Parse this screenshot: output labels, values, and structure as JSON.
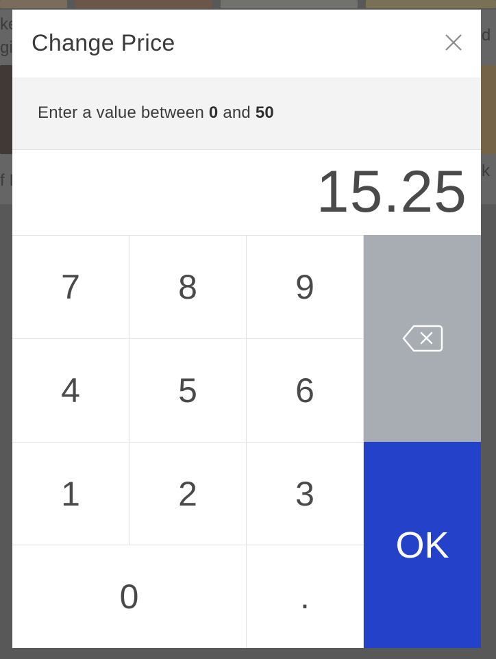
{
  "background": {
    "snippets": [
      "ke",
      "gi",
      "d",
      "f I",
      "k"
    ]
  },
  "dialog": {
    "title": "Change Price",
    "close_icon": "close-icon",
    "info": {
      "prefix": "Enter a value between ",
      "min": "0",
      "middle": " and ",
      "max": "50"
    },
    "display_value": "15.25"
  },
  "keypad": {
    "keys": {
      "k7": "7",
      "k8": "8",
      "k9": "9",
      "k4": "4",
      "k5": "5",
      "k6": "6",
      "k1": "1",
      "k2": "2",
      "k3": "3",
      "k0": "0",
      "kdot": "."
    },
    "backspace_icon": "backspace-icon",
    "ok_label": "OK"
  },
  "colors": {
    "ok_button": "#2342c9",
    "backspace_button": "#a8adb4",
    "info_bar": "#f3f3f3"
  }
}
